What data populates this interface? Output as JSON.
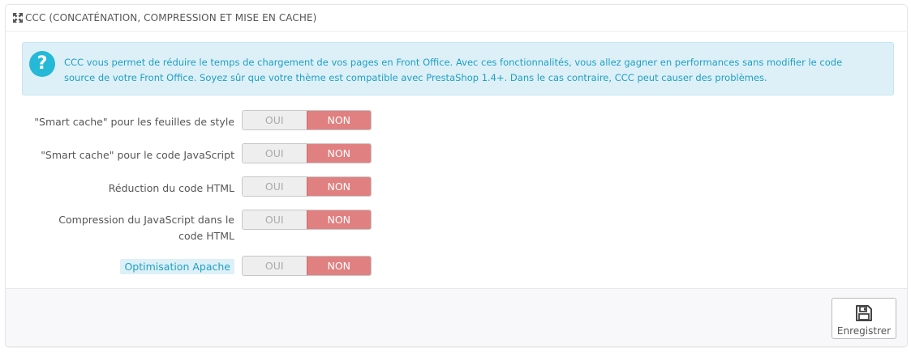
{
  "panel": {
    "title": "CCC (CONCATÉNATION, COMPRESSION ET MISE EN CACHE)",
    "title_icon": "expand-arrows-icon"
  },
  "alert": {
    "icon": "question-icon",
    "icon_glyph": "?",
    "text": "CCC vous permet de réduire le temps de chargement de vos pages en Front Office. Avec ces fonctionnalités, vous allez gagner en performances sans modifier le code source de votre Front Office. Soyez sûr que votre thème est compatible avec PrestaShop 1.4+. Dans le cas contraire, CCC peut causer des problèmes."
  },
  "options": [
    {
      "label": "\"Smart cache\" pour les feuilles de style",
      "yes": "OUI",
      "no": "NON",
      "selected": "NON"
    },
    {
      "label": "\"Smart cache\" pour le code JavaScript",
      "yes": "OUI",
      "no": "NON",
      "selected": "NON"
    },
    {
      "label": "Réduction du code HTML",
      "yes": "OUI",
      "no": "NON",
      "selected": "NON"
    },
    {
      "label": "Compression du JavaScript dans le code HTML",
      "yes": "OUI",
      "no": "NON",
      "selected": "NON"
    },
    {
      "label": "Optimisation Apache",
      "yes": "OUI",
      "no": "NON",
      "selected": "NON"
    }
  ],
  "footer": {
    "save_label": "Enregistrer",
    "save_icon": "floppy-disk-icon"
  },
  "colors": {
    "accent_blue": "#25b9d7",
    "alert_bg": "#ddf0f7",
    "switch_off_red": "#e08080",
    "switch_on_gray": "#eeeeee"
  }
}
